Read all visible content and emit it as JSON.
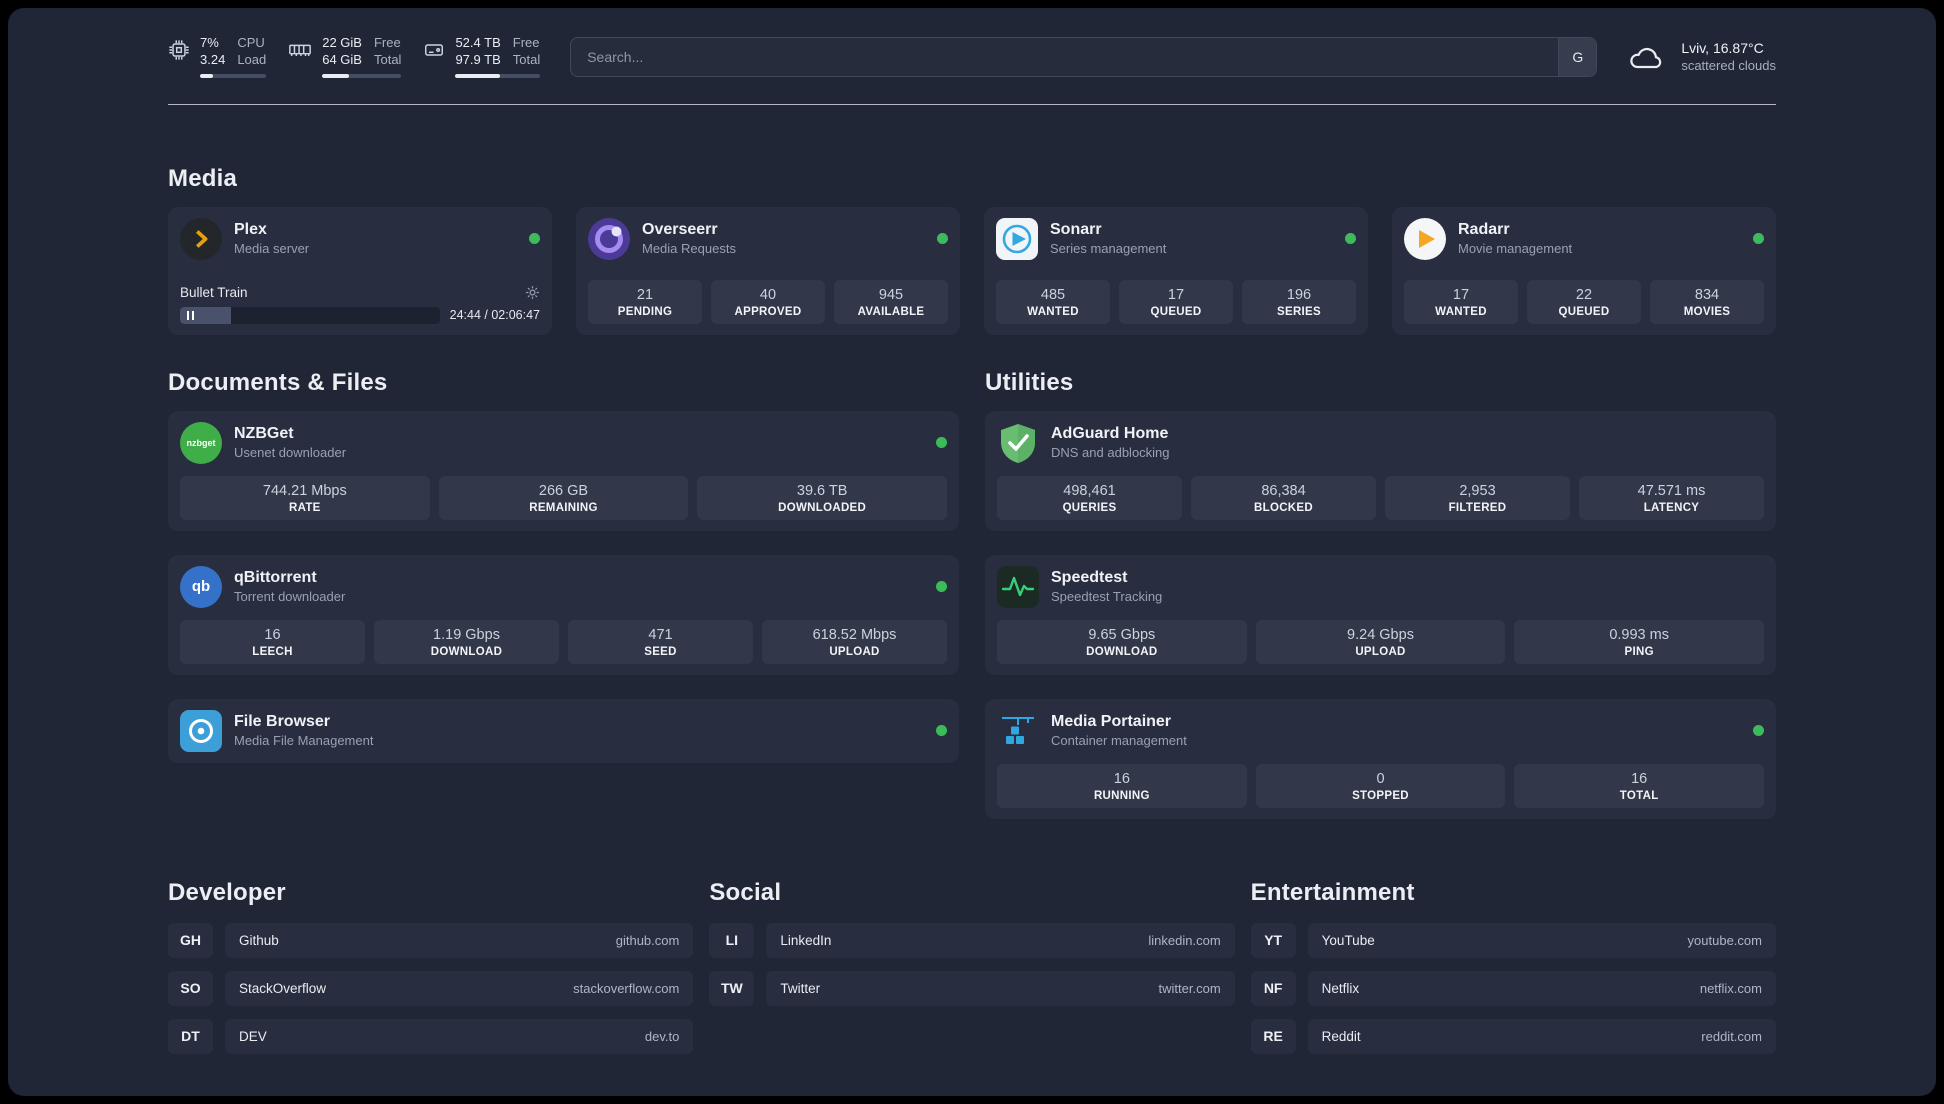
{
  "topbar": {
    "cpu": {
      "value_top": "7%",
      "value_bottom": "3.24",
      "label_top": "CPU",
      "label_bottom": "Load",
      "fill": 20
    },
    "memory": {
      "value_top": "22 GiB",
      "value_bottom": "64 GiB",
      "label_top": "Free",
      "label_bottom": "Total",
      "fill": 34
    },
    "disk": {
      "value_top": "52.4 TB",
      "value_bottom": "97.9 TB",
      "label_top": "Free",
      "label_bottom": "Total",
      "fill": 53
    },
    "search": {
      "placeholder": "Search...",
      "engine_label": "G"
    },
    "weather": {
      "location": "Lviv, 16.87°C",
      "condition": "scattered clouds"
    }
  },
  "section_titles": {
    "media": "Media",
    "documents": "Documents & Files",
    "utilities": "Utilities",
    "developer": "Developer",
    "social": "Social",
    "entertainment": "Entertainment"
  },
  "services": {
    "plex": {
      "name": "Plex",
      "desc": "Media server",
      "now_playing": "Bullet Train",
      "time": "24:44 / 02:06:47",
      "progress": 19.5
    },
    "overseerr": {
      "name": "Overseerr",
      "desc": "Media Requests",
      "stats": [
        {
          "value": "21",
          "label": "PENDING"
        },
        {
          "value": "40",
          "label": "APPROVED"
        },
        {
          "value": "945",
          "label": "AVAILABLE"
        }
      ]
    },
    "sonarr": {
      "name": "Sonarr",
      "desc": "Series management",
      "stats": [
        {
          "value": "485",
          "label": "WANTED"
        },
        {
          "value": "17",
          "label": "QUEUED"
        },
        {
          "value": "196",
          "label": "SERIES"
        }
      ]
    },
    "radarr": {
      "name": "Radarr",
      "desc": "Movie management",
      "stats": [
        {
          "value": "17",
          "label": "WANTED"
        },
        {
          "value": "22",
          "label": "QUEUED"
        },
        {
          "value": "834",
          "label": "MOVIES"
        }
      ]
    },
    "nzbget": {
      "name": "NZBGet",
      "desc": "Usenet downloader",
      "icon_text": "nzbget",
      "stats": [
        {
          "value": "744.21 Mbps",
          "label": "RATE"
        },
        {
          "value": "266 GB",
          "label": "REMAINING"
        },
        {
          "value": "39.6 TB",
          "label": "DOWNLOADED"
        }
      ]
    },
    "qbittorrent": {
      "name": "qBittorrent",
      "desc": "Torrent downloader",
      "icon_text": "qb",
      "stats": [
        {
          "value": "16",
          "label": "LEECH"
        },
        {
          "value": "1.19 Gbps",
          "label": "DOWNLOAD"
        },
        {
          "value": "471",
          "label": "SEED"
        },
        {
          "value": "618.52 Mbps",
          "label": "UPLOAD"
        }
      ]
    },
    "filebrowser": {
      "name": "File Browser",
      "desc": "Media File Management"
    },
    "adguard": {
      "name": "AdGuard Home",
      "desc": "DNS and adblocking",
      "stats": [
        {
          "value": "498,461",
          "label": "QUERIES"
        },
        {
          "value": "86,384",
          "label": "BLOCKED"
        },
        {
          "value": "2,953",
          "label": "FILTERED"
        },
        {
          "value": "47.571 ms",
          "label": "LATENCY"
        }
      ]
    },
    "speedtest": {
      "name": "Speedtest",
      "desc": "Speedtest Tracking",
      "stats": [
        {
          "value": "9.65 Gbps",
          "label": "DOWNLOAD"
        },
        {
          "value": "9.24 Gbps",
          "label": "UPLOAD"
        },
        {
          "value": "0.993 ms",
          "label": "PING"
        }
      ]
    },
    "portainer": {
      "name": "Media Portainer",
      "desc": "Container management",
      "stats": [
        {
          "value": "16",
          "label": "RUNNING"
        },
        {
          "value": "0",
          "label": "STOPPED"
        },
        {
          "value": "16",
          "label": "TOTAL"
        }
      ]
    }
  },
  "bookmarks": {
    "developer": [
      {
        "abbr": "GH",
        "name": "Github",
        "href": "github.com"
      },
      {
        "abbr": "SO",
        "name": "StackOverflow",
        "href": "stackoverflow.com"
      },
      {
        "abbr": "DT",
        "name": "DEV",
        "href": "dev.to"
      }
    ],
    "social": [
      {
        "abbr": "LI",
        "name": "LinkedIn",
        "href": "linkedin.com"
      },
      {
        "abbr": "TW",
        "name": "Twitter",
        "href": "twitter.com"
      }
    ],
    "entertainment": [
      {
        "abbr": "YT",
        "name": "YouTube",
        "href": "youtube.com"
      },
      {
        "abbr": "NF",
        "name": "Netflix",
        "href": "netflix.com"
      },
      {
        "abbr": "RE",
        "name": "Reddit",
        "href": "reddit.com"
      }
    ]
  },
  "colors": {
    "status_online": "#3dbb5c",
    "plex_accent": "#e5a00d",
    "background": "#202636",
    "card": "#282e3f"
  }
}
